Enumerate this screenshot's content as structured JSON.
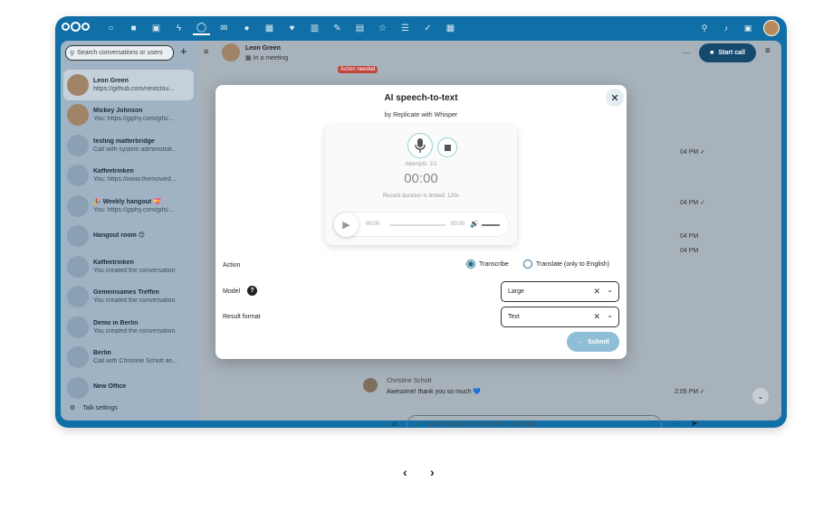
{
  "topbar": {
    "app_icons": [
      "dashboard-icon",
      "files-icon",
      "photos-icon",
      "activity-icon",
      "talk-icon",
      "mail-icon",
      "contacts-icon",
      "calendar-icon",
      "health-icon",
      "analytics-icon",
      "notes-icon",
      "deck-icon",
      "favorites-icon",
      "tasks-icon",
      "checklist-icon",
      "tables-icon"
    ],
    "right_icons": [
      "search-icon",
      "notifications-icon",
      "contacts-menu-icon"
    ]
  },
  "sidebar": {
    "search_placeholder": "Search conversations or users",
    "conversations": [
      {
        "name": "Leon Green",
        "sub": "https://github.com/nextclou..."
      },
      {
        "name": "Mickey Johnson",
        "sub": "You: https://giphy.com/gifs/..."
      },
      {
        "name": "testing matterbridge",
        "sub": "Call with system administrat..."
      },
      {
        "name": "Kaffeetrinken",
        "sub": "You: https://www.themovied..."
      },
      {
        "name": "🎉 Weekly hangout 💝",
        "sub": "You: https://giphy.com/gifs/..."
      },
      {
        "name": "Hangout room 😊",
        "sub": ""
      },
      {
        "name": "Kaffeetrinken",
        "sub": "You created the conversation"
      },
      {
        "name": "Gemeinsames Treffen",
        "sub": "You created the conversation"
      },
      {
        "name": "Demo in Berlin",
        "sub": "You created the conversation"
      },
      {
        "name": "Berlin",
        "sub": "Call with Christine Schott an..."
      },
      {
        "name": "New Office",
        "sub": ""
      }
    ],
    "settings_label": "Talk settings"
  },
  "chat": {
    "contact_name": "Leon Green",
    "contact_status": "In a meeting",
    "start_call_label": "Start call",
    "action_badge": "Action needed",
    "last_author": "Christine Schott",
    "last_message": "Awesome! thank you so much 💙",
    "times": [
      "04 PM",
      "04 PM",
      "04 PM",
      "04 PM",
      "2:05 PM"
    ],
    "composer_placeholder": "Write message, @ to mention someone ..."
  },
  "modal": {
    "title": "AI speech-to-text",
    "subtitle": "by Replicate with Whisper",
    "attempts": "Attempts: 1/1",
    "timer": "00:00",
    "limit_note": "Record duration is limited: 120s",
    "player_start": "00:00",
    "player_end": "00:00",
    "action_label": "Action",
    "action_options": [
      "Transcribe",
      "Translate (only to English)"
    ],
    "action_selected": "Transcribe",
    "model_label": "Model",
    "model_value": "Large",
    "format_label": "Result format",
    "format_value": "Text",
    "submit_label": "Submit"
  }
}
